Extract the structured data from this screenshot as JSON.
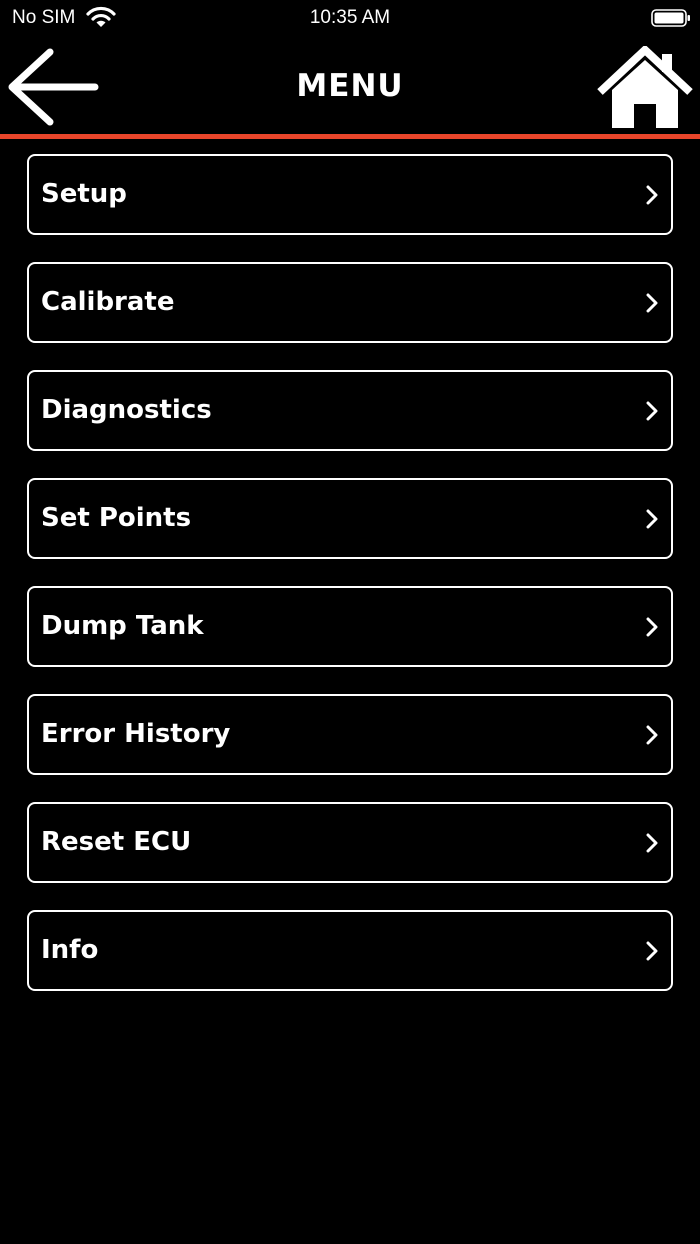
{
  "status_bar": {
    "carrier": "No SIM",
    "time": "10:35 AM"
  },
  "nav": {
    "title": "MENU",
    "back_icon": "arrow-left-icon",
    "home_icon": "home-icon"
  },
  "colors": {
    "background": "#000000",
    "text": "#ffffff",
    "accent": "#e8452a"
  },
  "menu": {
    "items": [
      {
        "label": "Setup"
      },
      {
        "label": "Calibrate"
      },
      {
        "label": "Diagnostics"
      },
      {
        "label": "Set Points"
      },
      {
        "label": "Dump Tank"
      },
      {
        "label": "Error History"
      },
      {
        "label": "Reset ECU"
      },
      {
        "label": "Info"
      }
    ]
  }
}
